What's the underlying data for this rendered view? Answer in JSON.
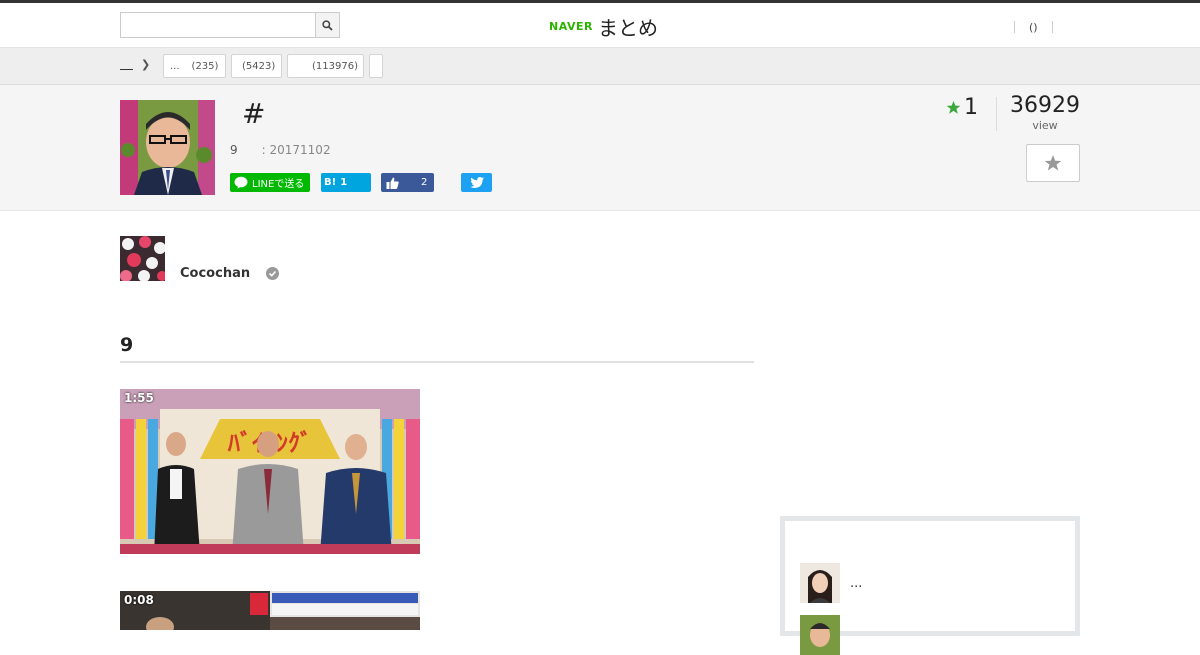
{
  "header": {
    "search": {
      "value": "",
      "placeholder": ""
    },
    "logo": {
      "brand": "NAVER",
      "product": "まとめ"
    },
    "user_menu": {
      "label": "()"
    }
  },
  "breadcrumb": {
    "home_label": "",
    "tags": [
      {
        "label": "...",
        "count": "(235)"
      },
      {
        "label": "",
        "count": "(5423)"
      },
      {
        "label": "",
        "count": "(113976)"
      },
      {
        "label": "",
        "count": ""
      }
    ]
  },
  "article": {
    "title": "#",
    "item_count": "9",
    "updated": ": 20171102",
    "share": {
      "line_label": "LINEで送る",
      "hatena_label": "B!",
      "hatena_count": "1",
      "facebook_count": "2"
    },
    "favorites": "1",
    "views": "36929",
    "views_label": "view"
  },
  "author": {
    "name": "Cocochan"
  },
  "section": {
    "heading": "9",
    "images": [
      {
        "timestamp": "1:55"
      },
      {
        "timestamp": "0:08"
      }
    ]
  },
  "sidebar": {
    "related": [
      {
        "title": "..."
      },
      {
        "title": ""
      }
    ]
  },
  "colors": {
    "naver_green": "#2db400",
    "line_green": "#00b900",
    "hatena_blue": "#00a4de",
    "facebook_blue": "#3b5998",
    "twitter_blue": "#1da1f2",
    "favorite_star": "#3ea83e"
  }
}
